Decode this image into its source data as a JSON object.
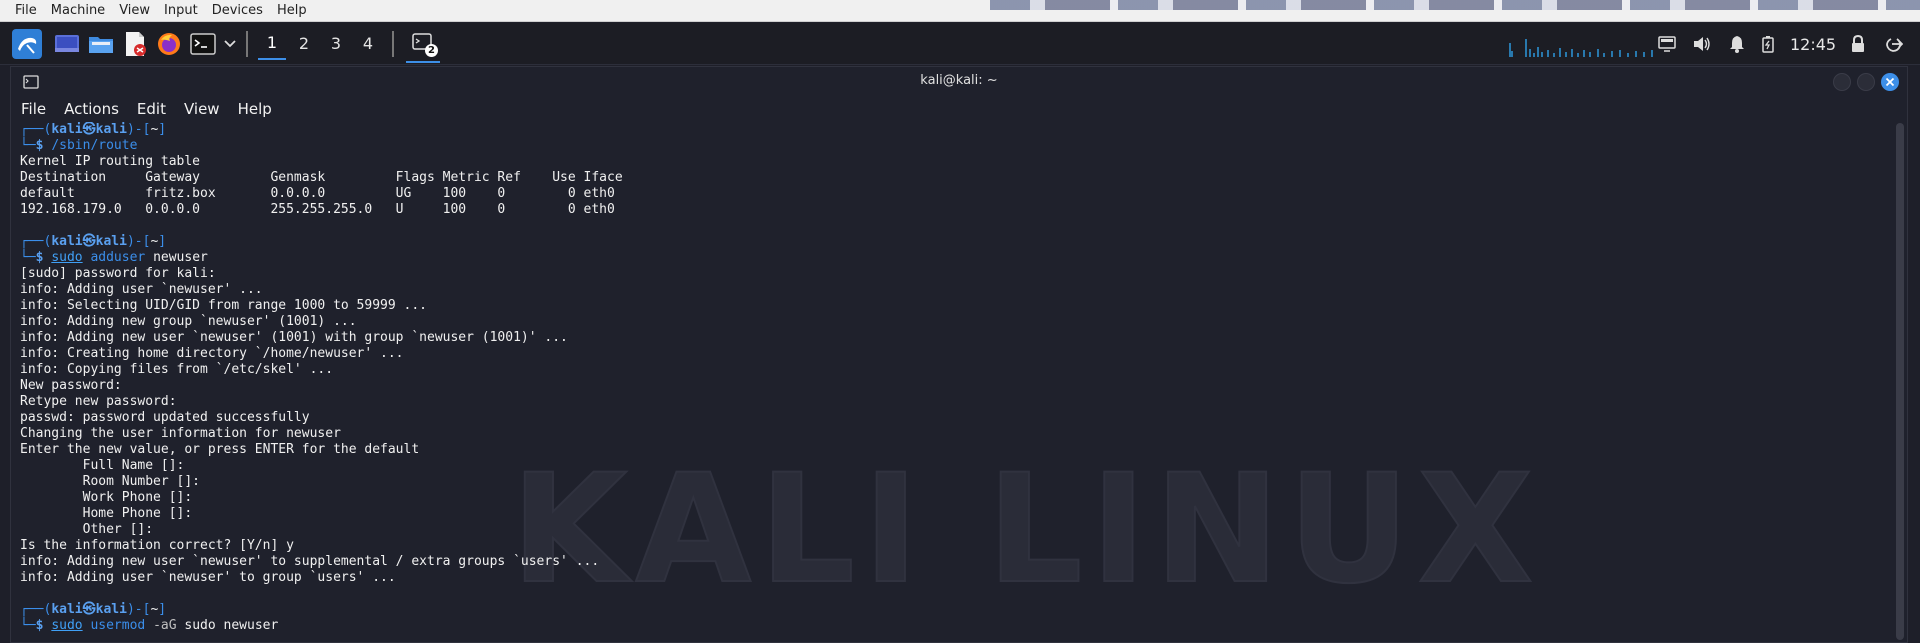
{
  "host_menu": [
    "File",
    "Machine",
    "View",
    "Input",
    "Devices",
    "Help"
  ],
  "panel": {
    "workspaces": [
      "1",
      "2",
      "3",
      "4"
    ],
    "active_workspace": "1",
    "terminal_badge": "2",
    "clock": "12:45",
    "icons": [
      "kali-menu-icon",
      "desktop-icon",
      "file-manager-icon",
      "text-editor-icon",
      "firefox-icon",
      "terminal-icon",
      "chevron-down-icon",
      "network-icon",
      "volume-icon",
      "notification-icon",
      "battery-icon",
      "lock-icon",
      "logout-icon"
    ]
  },
  "window": {
    "title": "kali@kali: ~",
    "menu": [
      "File",
      "Actions",
      "Edit",
      "View",
      "Help"
    ]
  },
  "watermark": "KALI LINUX",
  "terminal": {
    "prompt_user": "kali",
    "prompt_host": "kali",
    "prompt_dir": "~",
    "blocks": [
      {
        "command": "/sbin/route",
        "output": [
          "Kernel IP routing table",
          "Destination     Gateway         Genmask         Flags Metric Ref    Use Iface",
          "default         fritz.box       0.0.0.0         UG    100    0        0 eth0",
          "192.168.179.0   0.0.0.0         255.255.255.0   U     100    0        0 eth0",
          ""
        ]
      },
      {
        "command_sudo": "sudo",
        "command": "adduser",
        "args": " newuser",
        "output": [
          "[sudo] password for kali:",
          "info: Adding user `newuser' ...",
          "info: Selecting UID/GID from range 1000 to 59999 ...",
          "info: Adding new group `newuser' (1001) ...",
          "info: Adding new user `newuser' (1001) with group `newuser (1001)' ...",
          "info: Creating home directory `/home/newuser' ...",
          "info: Copying files from `/etc/skel' ...",
          "New password:",
          "Retype new password:",
          "passwd: password updated successfully",
          "Changing the user information for newuser",
          "Enter the new value, or press ENTER for the default",
          "        Full Name []:",
          "        Room Number []:",
          "        Work Phone []:",
          "        Home Phone []:",
          "        Other []:",
          "Is the information correct? [Y/n] y",
          "info: Adding new user `newuser' to supplemental / extra groups `users' ...",
          "info: Adding user `newuser' to group `users' ...",
          ""
        ]
      },
      {
        "command_sudo": "sudo",
        "command": "usermod",
        "flag": " -aG",
        "args": " sudo newuser",
        "output": []
      }
    ]
  }
}
